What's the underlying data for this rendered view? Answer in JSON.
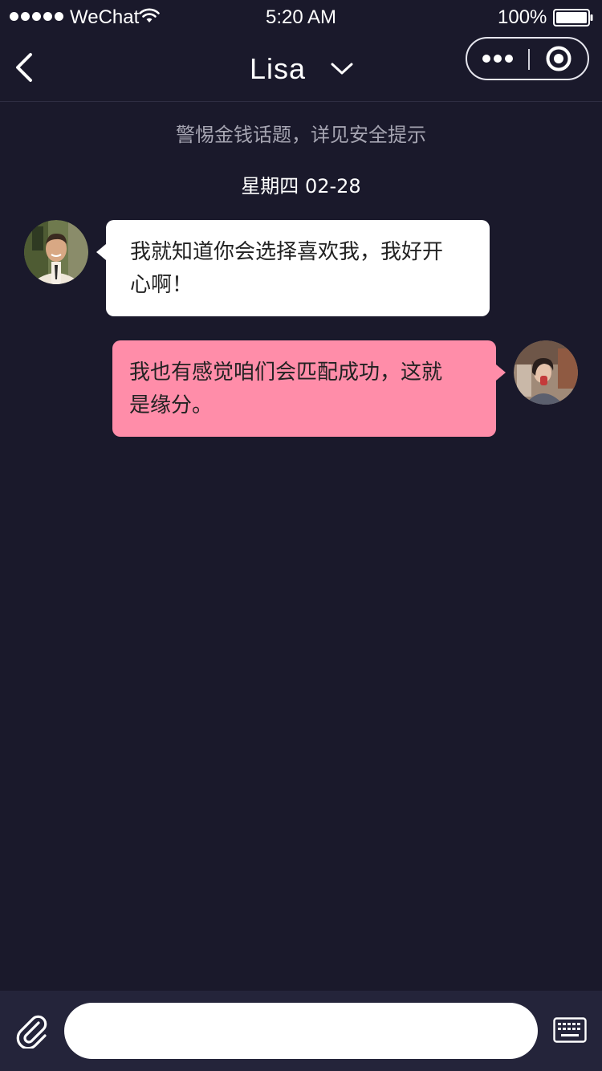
{
  "status_bar": {
    "carrier": "WeChat",
    "time": "5:20 AM",
    "battery": "100%",
    "icons": [
      "signal-dots-icon",
      "wifi-icon",
      "battery-icon"
    ]
  },
  "nav": {
    "title": "Lisa",
    "icons": [
      "back-arrow-icon",
      "chevron-down-icon",
      "more-dots-icon",
      "close-circle-icon"
    ]
  },
  "chat": {
    "notice": "警惕金钱话题，详见安全提示",
    "date": "星期四 02-28",
    "messages": [
      {
        "side": "left",
        "avatar": "male-user-avatar",
        "lines": [
          "我就知道你会选择喜欢我，我好开",
          "心啊！"
        ]
      },
      {
        "side": "right",
        "avatar": "female-user-avatar",
        "lines": [
          "我也有感觉咱们会匹配成功，这就",
          "是缘分。"
        ]
      }
    ]
  },
  "input_bar": {
    "placeholder": "",
    "icons": [
      "paperclip-icon",
      "keyboard-icon"
    ]
  },
  "colors": {
    "background": "#1a192b",
    "incoming_bubble": "#ffffff",
    "outgoing_bubble": "#ff8da9",
    "bottom_bar": "#24243a"
  }
}
